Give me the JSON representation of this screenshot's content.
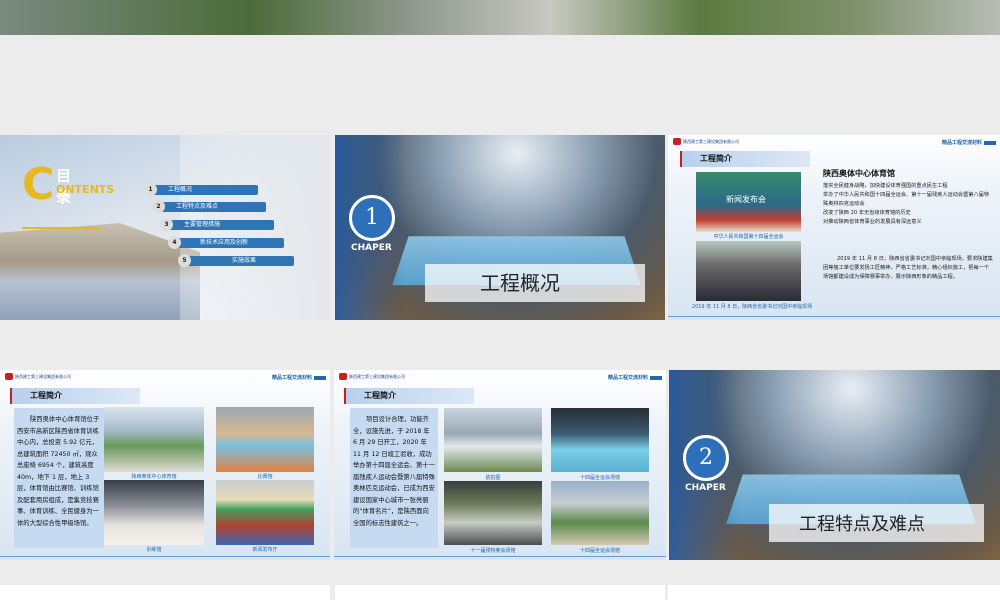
{
  "slides": [
    {
      "type": "contents",
      "title_cn": "目 录",
      "title_en_initial": "C",
      "title_en_rest": "ONTENTS",
      "items": [
        {
          "num": "1",
          "label": "工程概况"
        },
        {
          "num": "2",
          "label": "工程特点及难点"
        },
        {
          "num": "3",
          "label": "主要管理措施"
        },
        {
          "num": "4",
          "label": "新技术应用及创新"
        },
        {
          "num": "5",
          "label": "实施效果"
        }
      ]
    },
    {
      "type": "chapter",
      "number": "1",
      "chapter_label": "CHAPER",
      "title": "工程概况"
    },
    {
      "type": "info",
      "company": "陕西建工第三建设集团有限公司",
      "header_right": "精品工程交流材料",
      "section": "工程简介",
      "heading": "陕西奥体中心体育馆",
      "paragraphs": [
        "落实全民健身战略，加快建设体育强国的重点民生工程",
        "举办了中华人民共和国十四届全运会、第十一届残疾人运动会暨第八届特殊奥林匹克运动会",
        "改变了陕西 20 年无省级体育馆的历史",
        "对推动陕西省体育事业的发展具有深远意义"
      ],
      "paragraph2": "2019 年 11 月 8 日，陕西省省委书记刘国中亲临现场，要求陕建集团等施工单位要发扬工匠精神，严格工艺标准，精心组织施工，把每一个场馆都建设成为保障赛事举办、展示陕西形象的精品工程。",
      "captions": [
        "中华人民共和国第十四届全运会",
        "2019 年 11 月 8 日，陕西省省委书记刘国中亲临现场"
      ],
      "photo_text": "新闻发布会"
    },
    {
      "type": "info",
      "company": "陕西建工第三建设集团有限公司",
      "header_right": "精品工程交流材料",
      "section": "工程简介",
      "body": "陕西奥体中心体育馆位于西安市高新区陕西省体育训练中心内，总投资 5.92 亿元，总建筑面积 72450 ㎡，观众总座椅 6954 个，建筑高度 40m，地下 1 层，地上 3 层，体育馆由比赛馆、训练馆及配套用房组成，是集竞技赛事、体育训练、全民健身为一体的大型综合性甲级场馆。",
      "captions": [
        "陕西奥体中心体育馆",
        "比赛馆",
        "训练馆",
        "新闻发布厅"
      ]
    },
    {
      "type": "info",
      "company": "陕西建工第三建设集团有限公司",
      "header_right": "精品工程交流材料",
      "section": "工程简介",
      "body": "项目设计合理，功能齐全，设施先进，于 2018 年 6 月 29 日开工，2020 年 11 月 12 日竣工验收，成功举办第十四届全运会、第十一届残疾人运动会暨第八届特殊奥林匹克运动会，已成为西安建设国家中心城市一张亮丽的“体育名片”，是陕西面向全国的标志性建筑之一。",
      "captions": [
        "航拍图",
        "十四届全运会场馆",
        "十一届残特奥会场馆",
        "十四届全运会场馆"
      ]
    },
    {
      "type": "chapter",
      "number": "2",
      "chapter_label": "CHAPER",
      "title": "工程特点及难点"
    }
  ]
}
